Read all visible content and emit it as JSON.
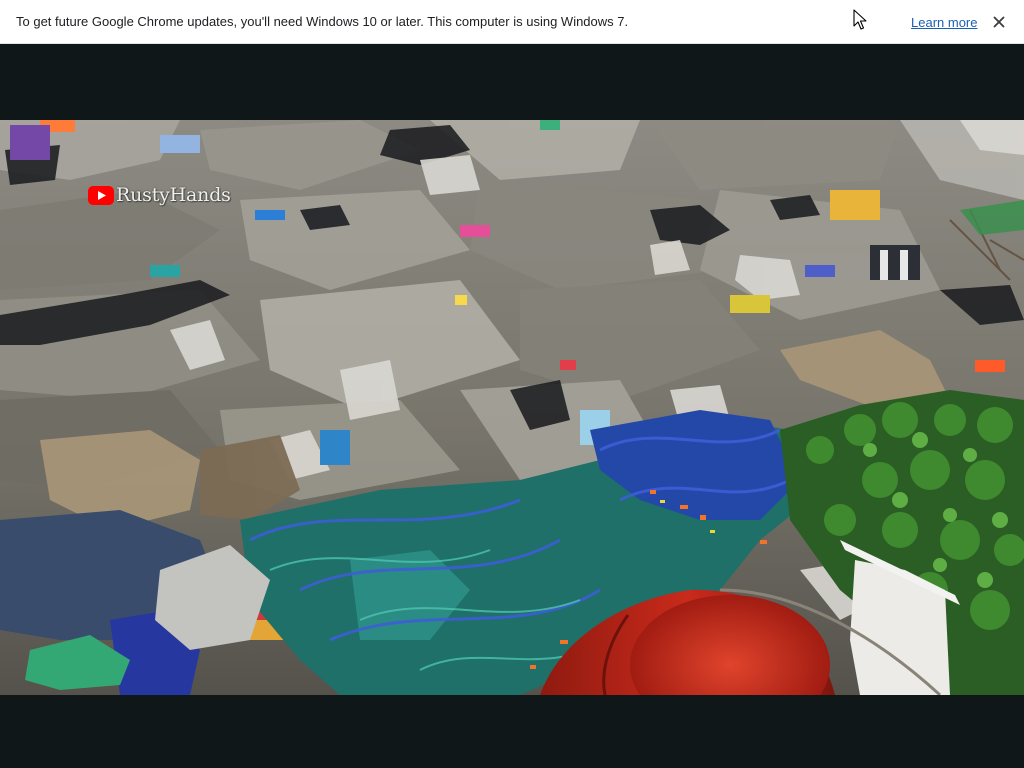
{
  "infobar": {
    "message": "To get future Google Chrome updates, you'll need Windows 10 or later. This computer is using Windows 7.",
    "learn_more_label": "Learn more",
    "close_icon": "close-icon",
    "background": "#ffffff",
    "link_color": "#1a5fb4"
  },
  "player": {
    "background": "#101719",
    "watermark": {
      "icon": "youtube-logo-icon",
      "label": "RustyHands",
      "icon_color": "#ff0000"
    },
    "scene": "landfill-garbage-image"
  },
  "cursor": {
    "icon": "mouse-pointer-icon"
  }
}
